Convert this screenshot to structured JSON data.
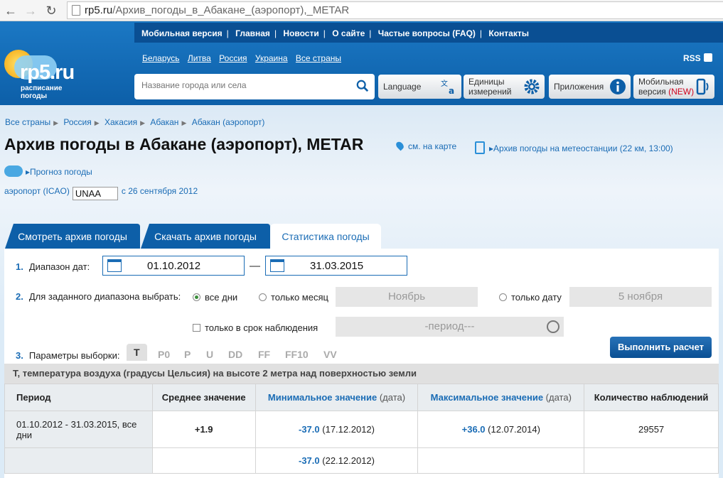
{
  "browser": {
    "url_host": "rp5.ru",
    "url_path": "/Архив_погоды_в_Абакане_(аэропорт),_METAR"
  },
  "topnav": {
    "items": [
      "Мобильная версия",
      "Главная",
      "Новости",
      "О сайте",
      "Частые вопросы (FAQ)",
      "Контакты"
    ]
  },
  "logo": {
    "text": "rp5.ru",
    "subtitle": "расписание погоды"
  },
  "countries": [
    "Беларусь",
    "Литва",
    "Россия",
    "Украина",
    "Все страны"
  ],
  "rss": "RSS",
  "search": {
    "placeholder": "Название города или села"
  },
  "header_buttons": {
    "language": "Language",
    "units_line1": "Единицы",
    "units_line2": "измерений",
    "apps": "Приложения",
    "mobile_line1": "Мобильная",
    "mobile_line2": "версия",
    "mobile_new": "(NEW)"
  },
  "breadcrumb": [
    "Все страны",
    "Россия",
    "Хакасия",
    "Абакан",
    "Абакан (аэропорт)"
  ],
  "title": "Архив погоды в Абакане (аэропорт), METAR",
  "map_link": "см. на карте",
  "archive_link": "Архив погоды на метеостанции (22 км, 13:00)",
  "forecast_link": "Прогноз погоды",
  "icao": {
    "label": "аэропорт (ICAO)",
    "value": "UNAA",
    "since": "с 26 сентября 2012"
  },
  "tabs": [
    "Смотреть архив погоды",
    "Скачать архив погоды",
    "Статистика погоды"
  ],
  "form": {
    "row1_num": "1.",
    "row1_label": "Диапазон дат:",
    "date_from": "01.10.2012",
    "date_sep": "—",
    "date_to": "31.03.2015",
    "row2_num": "2.",
    "row2_label": "Для заданного диапазона выбрать:",
    "opt_all": "все дни",
    "opt_month": "только месяц",
    "month_value": "Ноябрь",
    "opt_date": "только дату",
    "date_value": "5 ноября",
    "opt_obs": "только в срок наблюдения",
    "period_value": "-период---",
    "row3_num": "3.",
    "row3_label": "Параметры выборки:",
    "params": [
      "T",
      "P0",
      "P",
      "U",
      "DD",
      "FF",
      "FF10",
      "VV"
    ],
    "run_button": "Выполнить расчет"
  },
  "description": "T, температура воздуха (градусы Цельсия) на высоте 2 метра над поверхностью земли",
  "table": {
    "headers": {
      "period": "Период",
      "avg": "Среднее значение",
      "min": "Минимальное значение",
      "min_suffix": "(дата)",
      "max": "Максимальное значение",
      "max_suffix": "(дата)",
      "count": "Количество наблюдений"
    },
    "row1": {
      "period": "01.10.2012 - 31.03.2015, все дни",
      "avg": "+1.9",
      "min_val": "-37.0",
      "min_date": "(17.12.2012)",
      "max_val": "+36.0",
      "max_date": "(12.07.2014)",
      "count": "29557"
    },
    "row2": {
      "min_val": "-37.0",
      "min_date": "(22.12.2012)"
    }
  }
}
